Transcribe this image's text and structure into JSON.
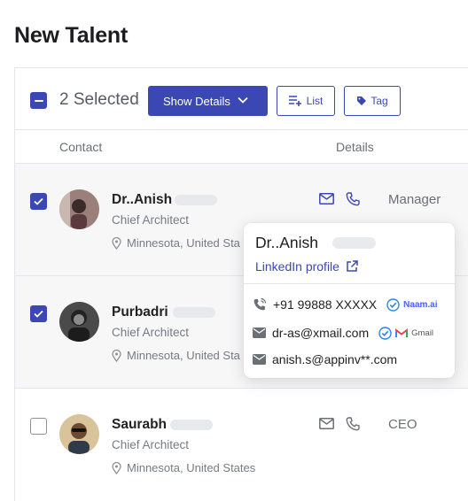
{
  "page": {
    "title": "New Talent"
  },
  "toolbar": {
    "selected_label": "2 Selected",
    "show_details_label": "Show Details",
    "list_label": "List",
    "tag_label": "Tag"
  },
  "table": {
    "headers": {
      "contact": "Contact",
      "details": "Details"
    }
  },
  "rows": [
    {
      "name": "Dr..Anish",
      "title": "Chief Architect",
      "location": "Minnesota, United States",
      "location_visible": "Minnesota, United Sta",
      "role": "Manager",
      "checked": true
    },
    {
      "name": "Purbadri",
      "title": "Chief Architect",
      "location": "Minnesota, United States",
      "location_visible": "Minnesota, United Sta",
      "role": "",
      "checked": true
    },
    {
      "name": "Saurabh",
      "title": "Chief Architect",
      "location": "Minnesota, United States",
      "location_visible": "Minnesota, United States",
      "role": "CEO",
      "checked": false
    }
  ],
  "popover": {
    "name": "Dr..Anish",
    "linkedin_label": "LinkedIn profile",
    "phone": "+91 99888 XXXXX",
    "phone_source": "Naam.ai",
    "email_1": "dr-as@xmail.com",
    "email_1_source": "Gmail",
    "email_2": "anish.s@appinv**.com"
  },
  "colors": {
    "accent": "#3b48b4",
    "row_selected_bg": "#f7f7f8",
    "border": "#e3e5ea"
  }
}
